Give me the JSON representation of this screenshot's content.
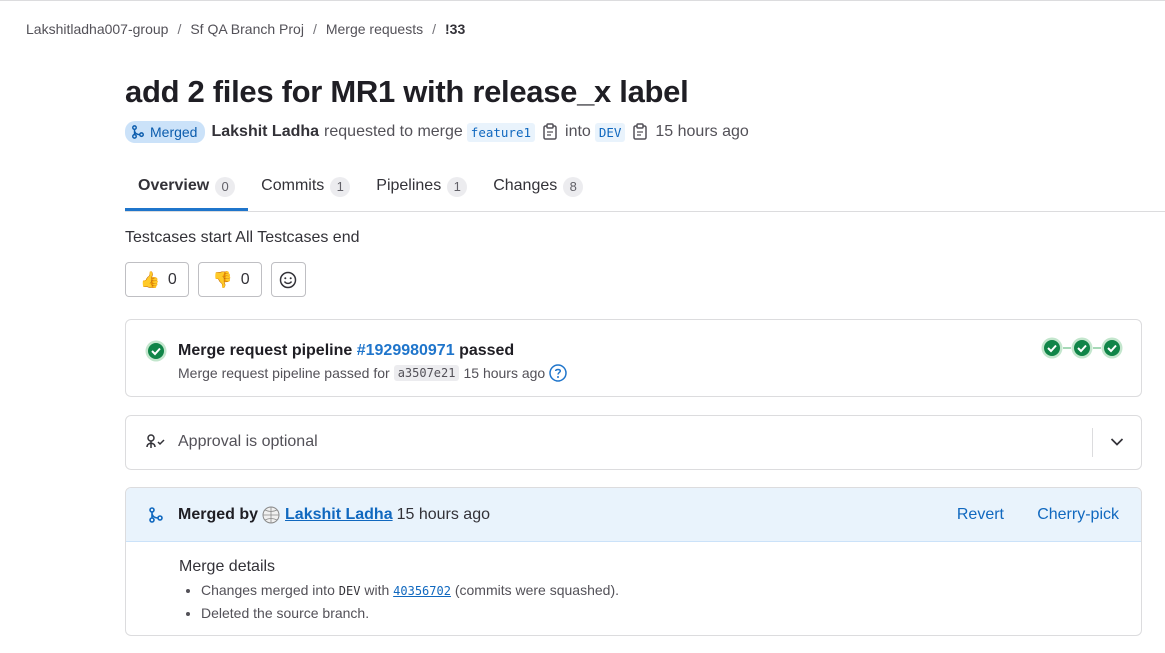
{
  "breadcrumb": {
    "group": "Lakshitladha007-group",
    "project": "Sf QA Branch Proj",
    "section": "Merge requests",
    "current": "!33",
    "separator": "/"
  },
  "mr": {
    "title": "add 2 files for MR1 with release_x label",
    "status": "Merged",
    "author": "Lakshit Ladha",
    "requested_text": "requested to merge",
    "source_branch": "feature1",
    "into_text": "into",
    "target_branch": "DEV",
    "time_ago": "15 hours ago"
  },
  "tabs": [
    {
      "label": "Overview",
      "count": "0"
    },
    {
      "label": "Commits",
      "count": "1"
    },
    {
      "label": "Pipelines",
      "count": "1"
    },
    {
      "label": "Changes",
      "count": "8"
    }
  ],
  "description": "Testcases start All Testcases end",
  "reactions": {
    "thumbs_up": "0",
    "thumbs_down": "0",
    "thumbs_up_emoji": "👍",
    "thumbs_down_emoji": "👎"
  },
  "pipeline": {
    "title_prefix": "Merge request pipeline",
    "id": "#1929980971",
    "status": "passed",
    "sub_prefix": "Merge request pipeline passed for",
    "sha": "a3507e21",
    "time_ago": "15 hours ago",
    "stages": [
      "success",
      "success",
      "success"
    ]
  },
  "approval": {
    "text": "Approval is optional"
  },
  "merge": {
    "merged_by_label": "Merged by",
    "user": "Lakshit Ladha",
    "time_ago": "15 hours ago",
    "revert_label": "Revert",
    "cherry_pick_label": "Cherry-pick",
    "details_title": "Merge details",
    "detail1_prefix": "Changes merged into",
    "detail1_branch": "DEV",
    "detail1_with": "with",
    "detail1_commit": "40356702",
    "detail1_suffix": "(commits were squashed).",
    "detail2": "Deleted the source branch."
  },
  "colors": {
    "accent": "#1f75cb",
    "success": "#108548",
    "merged_badge_bg": "#cbe2f9",
    "merged_header_bg": "#e9f3fc"
  }
}
